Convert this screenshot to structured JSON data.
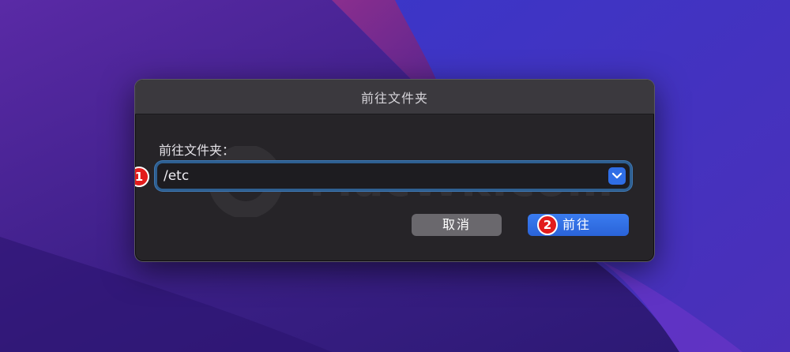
{
  "dialog": {
    "title": "前往文件夹",
    "field_label": "前往文件夹：",
    "path_value": "/etc",
    "cancel_label": "取消",
    "go_label": "前往",
    "combo_icon": "chevron-down-icon"
  },
  "annotations": {
    "step1": "1",
    "step2": "2"
  },
  "watermark": {
    "text": "MacWk.com"
  },
  "colors": {
    "accent": "#2f6ee6",
    "badge": "#e21c1c",
    "dialog_bg": "#262428"
  }
}
